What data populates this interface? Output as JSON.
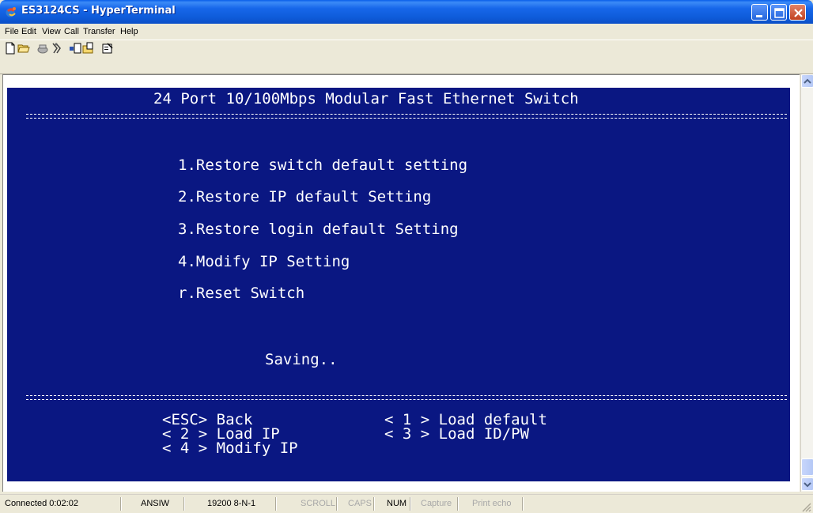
{
  "window": {
    "title": "ES3124CS - HyperTerminal"
  },
  "menu": [
    "File",
    "Edit",
    "View",
    "Call",
    "Transfer",
    "Help"
  ],
  "toolbar": {
    "icons": [
      "new-icon",
      "open-icon",
      "connect-icon",
      "disconnect-icon",
      "send-icon",
      "receive-icon",
      "properties-icon"
    ]
  },
  "terminal": {
    "header": "24 Port 10/100Mbps Modular Fast Ethernet Switch",
    "options": [
      "1.Restore switch default setting",
      "2.Restore IP default Setting",
      "3.Restore login default Setting",
      "4.Modify IP Setting",
      "r.Reset Switch"
    ],
    "status": "Saving..",
    "keys": {
      "back": "<ESC> Back",
      "load_default": "< 1 > Load default",
      "load_ip": "< 2 > Load IP",
      "load_idpw": "< 3 > Load ID/PW",
      "modify_ip": "< 4 > Modify IP"
    },
    "colors": {
      "background": "#0A1782",
      "text": "#FFFFFF"
    }
  },
  "statusbar": {
    "connected": "Connected 0:02:02",
    "emulation": "ANSIW",
    "port_settings": "19200 8-N-1",
    "scroll": "SCROLL",
    "caps": "CAPS",
    "num": "NUM",
    "capture": "Capture",
    "print_echo": "Print echo"
  }
}
